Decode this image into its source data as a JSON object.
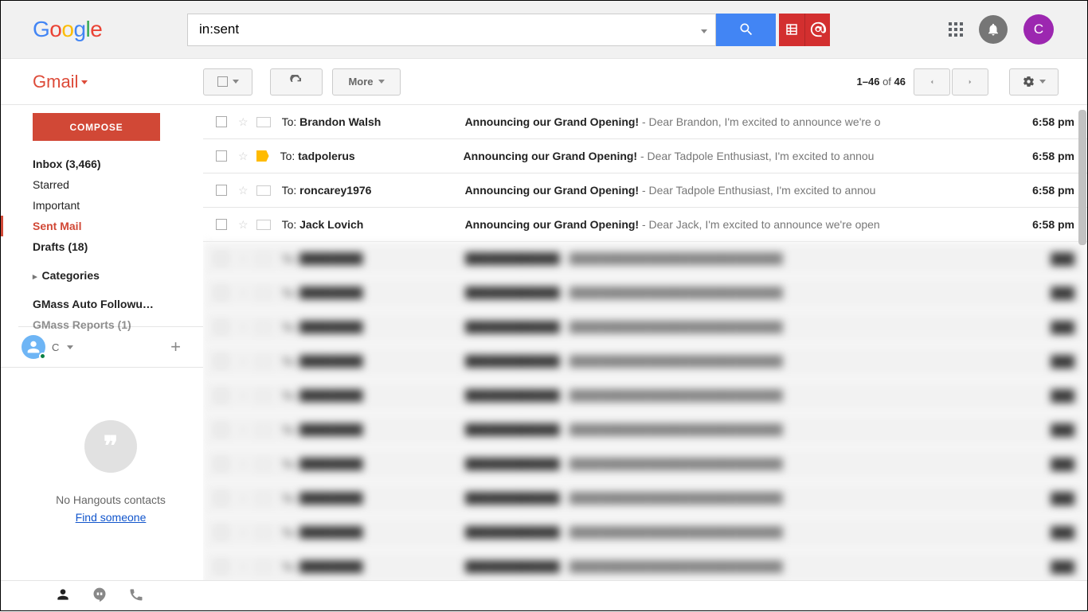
{
  "header": {
    "search_value": "in:sent",
    "avatar_initial": "C"
  },
  "subheader": {
    "app_label": "Gmail",
    "more_label": "More",
    "count_text_a": "1–46",
    "count_text_b": " of ",
    "count_text_c": "46"
  },
  "sidebar": {
    "compose_label": "COMPOSE",
    "items": [
      {
        "label": "Inbox (3,466)",
        "bold": true,
        "active": false
      },
      {
        "label": "Starred",
        "bold": false,
        "active": false
      },
      {
        "label": "Important",
        "bold": false,
        "active": false
      },
      {
        "label": "Sent Mail",
        "bold": true,
        "active": true
      },
      {
        "label": "Drafts (18)",
        "bold": true,
        "active": false
      }
    ],
    "categories_label": "Categories",
    "gmass_followup": "GMass Auto Followu…",
    "gmass_reports": "GMass Reports (1)",
    "hangout_initial": "C",
    "hangouts_empty_msg": "No Hangouts contacts",
    "hangouts_link": "Find someone"
  },
  "emails": [
    {
      "to_prefix": "To: ",
      "to": "Brandon Walsh",
      "subject": "Announcing our Grand Opening!",
      "snippet": " - Dear Brandon, I'm excited to announce we're o",
      "time": "6:58 pm",
      "tag": false
    },
    {
      "to_prefix": "To: ",
      "to": "tadpolerus",
      "subject": "Announcing our Grand Opening!",
      "snippet": " - Dear Tadpole Enthusiast, I'm excited to annou",
      "time": "6:58 pm",
      "tag": true
    },
    {
      "to_prefix": "To: ",
      "to": "roncarey1976",
      "subject": "Announcing our Grand Opening!",
      "snippet": " - Dear Tadpole Enthusiast, I'm excited to annou",
      "time": "6:58 pm",
      "tag": false
    },
    {
      "to_prefix": "To: ",
      "to": "Jack Lovich",
      "subject": "Announcing our Grand Opening!",
      "snippet": " - Dear Jack, I'm excited to announce we're open",
      "time": "6:58 pm",
      "tag": false
    }
  ]
}
